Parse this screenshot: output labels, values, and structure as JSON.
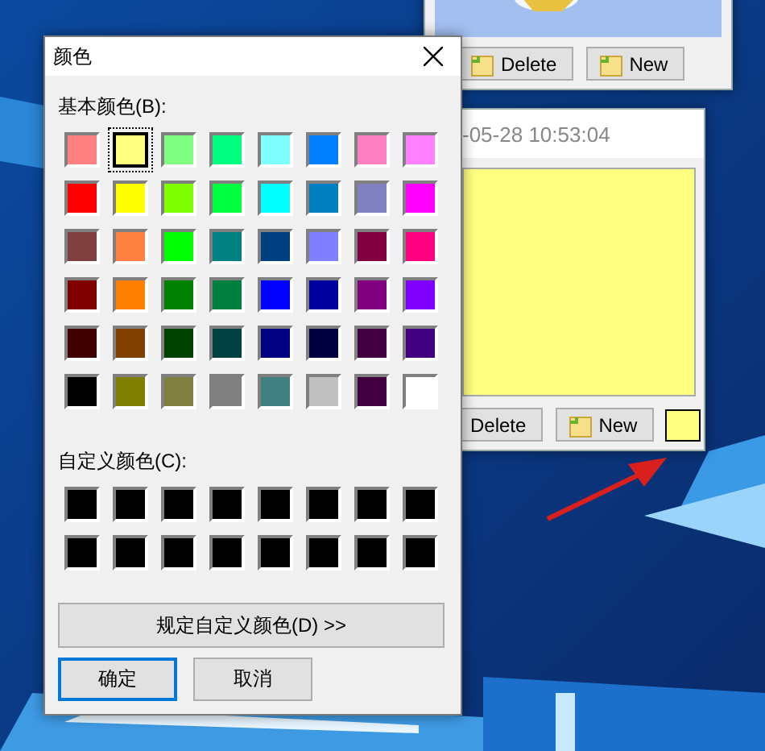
{
  "back_note": {
    "buttons": [
      "Delete",
      "New"
    ]
  },
  "front_note": {
    "timestamp": "-05-28 10:53:04",
    "color": "#ffff80",
    "buttons": [
      "Delete",
      "New"
    ]
  },
  "dialog": {
    "title": "颜色",
    "basic_label": "基本颜色(B):",
    "basic_colors": [
      {
        "color": "#ff8080",
        "selected": false
      },
      {
        "color": "#ffff80",
        "selected": true
      },
      {
        "color": "#80ff80",
        "selected": false
      },
      {
        "color": "#00ff80",
        "selected": false
      },
      {
        "color": "#80ffff",
        "selected": false
      },
      {
        "color": "#0080ff",
        "selected": false
      },
      {
        "color": "#ff80c0",
        "selected": false
      },
      {
        "color": "#ff80ff",
        "selected": false
      },
      {
        "color": "#ff0000",
        "selected": false
      },
      {
        "color": "#ffff00",
        "selected": false
      },
      {
        "color": "#80ff00",
        "selected": false
      },
      {
        "color": "#00ff40",
        "selected": false
      },
      {
        "color": "#00ffff",
        "selected": false
      },
      {
        "color": "#0080c0",
        "selected": false
      },
      {
        "color": "#8080c0",
        "selected": false
      },
      {
        "color": "#ff00ff",
        "selected": false
      },
      {
        "color": "#804040",
        "selected": false
      },
      {
        "color": "#ff8040",
        "selected": false
      },
      {
        "color": "#00ff00",
        "selected": false
      },
      {
        "color": "#008080",
        "selected": false
      },
      {
        "color": "#004080",
        "selected": false
      },
      {
        "color": "#8080ff",
        "selected": false
      },
      {
        "color": "#800040",
        "selected": false
      },
      {
        "color": "#ff0080",
        "selected": false
      },
      {
        "color": "#800000",
        "selected": false
      },
      {
        "color": "#ff8000",
        "selected": false
      },
      {
        "color": "#008000",
        "selected": false
      },
      {
        "color": "#008040",
        "selected": false
      },
      {
        "color": "#0000ff",
        "selected": false
      },
      {
        "color": "#0000a0",
        "selected": false
      },
      {
        "color": "#800080",
        "selected": false
      },
      {
        "color": "#8000ff",
        "selected": false
      },
      {
        "color": "#400000",
        "selected": false
      },
      {
        "color": "#804000",
        "selected": false
      },
      {
        "color": "#004000",
        "selected": false
      },
      {
        "color": "#004040",
        "selected": false
      },
      {
        "color": "#000080",
        "selected": false
      },
      {
        "color": "#000040",
        "selected": false
      },
      {
        "color": "#400040",
        "selected": false
      },
      {
        "color": "#400080",
        "selected": false
      },
      {
        "color": "#000000",
        "selected": false
      },
      {
        "color": "#808000",
        "selected": false
      },
      {
        "color": "#808040",
        "selected": false
      },
      {
        "color": "#808080",
        "selected": false
      },
      {
        "color": "#408080",
        "selected": false
      },
      {
        "color": "#c0c0c0",
        "selected": false
      },
      {
        "color": "#400040",
        "selected": false
      },
      {
        "color": "#ffffff",
        "selected": false
      }
    ],
    "custom_label": "自定义颜色(C):",
    "custom_colors": [
      {
        "color": "#000000"
      },
      {
        "color": "#000000"
      },
      {
        "color": "#000000"
      },
      {
        "color": "#000000"
      },
      {
        "color": "#000000"
      },
      {
        "color": "#000000"
      },
      {
        "color": "#000000"
      },
      {
        "color": "#000000"
      },
      {
        "color": "#000000"
      },
      {
        "color": "#000000"
      },
      {
        "color": "#000000"
      },
      {
        "color": "#000000"
      },
      {
        "color": "#000000"
      },
      {
        "color": "#000000"
      },
      {
        "color": "#000000"
      },
      {
        "color": "#000000"
      }
    ],
    "define_button": "规定自定义颜色(D) >>",
    "ok_button": "确定",
    "cancel_button": "取消"
  }
}
